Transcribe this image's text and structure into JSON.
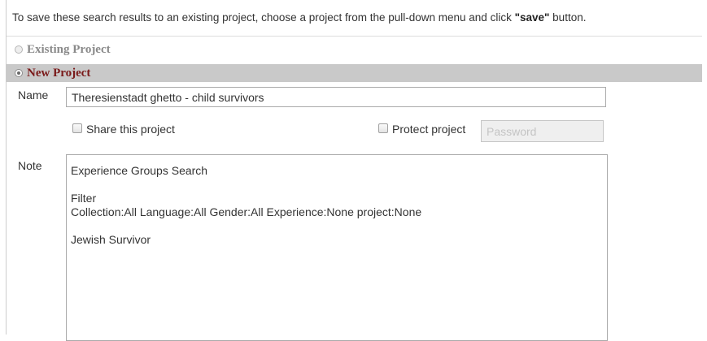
{
  "instruction": {
    "prefix": "To save these search results to an existing project, choose a project from the pull-down menu and click ",
    "emphasis": "\"save\"",
    "suffix": " button."
  },
  "options": {
    "existing_label": "Existing Project",
    "new_label": "New Project",
    "selected": "new"
  },
  "form": {
    "name_label": "Name",
    "name_value": "Theresienstadt ghetto - child survivors",
    "share_label": "Share this project",
    "share_checked": false,
    "protect_label": "Protect project",
    "protect_checked": false,
    "password_placeholder": "Password",
    "note_label": "Note",
    "note_lines": [
      "Experience Groups Search",
      "",
      "Filter",
      "Collection:All Language:All Gender:All Experience:None project:None",
      "",
      "Jewish Survivor"
    ]
  },
  "colors": {
    "new_project_text": "#7a1a1a",
    "selected_row_bg": "#c9c9c9"
  }
}
